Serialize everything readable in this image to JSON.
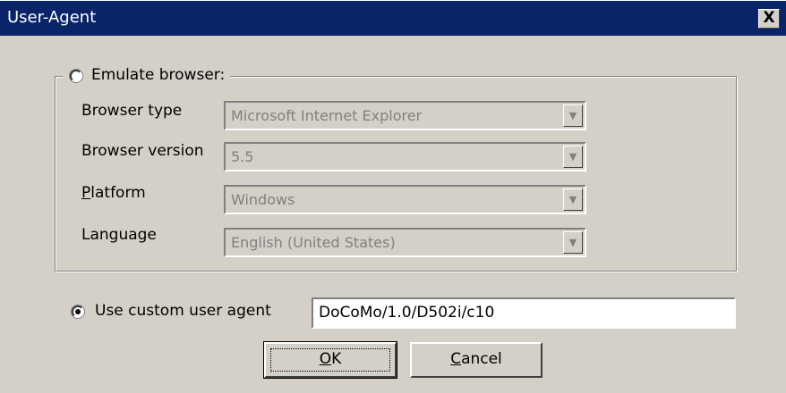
{
  "window": {
    "title": "User-Agent",
    "close_label": "X"
  },
  "emulate": {
    "label": "Emulate browser:",
    "fields": [
      {
        "label_pre": "",
        "label_accel": "",
        "label_post": "Browser type",
        "value": "Microsoft Internet Explorer"
      },
      {
        "label_pre": "",
        "label_accel": "",
        "label_post": "Browser version",
        "value": "5.5"
      },
      {
        "label_pre": "",
        "label_accel": "P",
        "label_post": "latform",
        "value": "Windows"
      },
      {
        "label_pre": "",
        "label_accel": "",
        "label_post": "Language",
        "value": "English (United States)"
      }
    ]
  },
  "custom": {
    "label": "Use custom user agent",
    "value": "DoCoMo/1.0/D502i/c10"
  },
  "buttons": {
    "ok_accel": "O",
    "ok_rest": "K",
    "cancel_accel": "C",
    "cancel_rest": "ancel"
  },
  "icons": {
    "dropdown": "down-triangle-icon",
    "close": "close-icon"
  }
}
